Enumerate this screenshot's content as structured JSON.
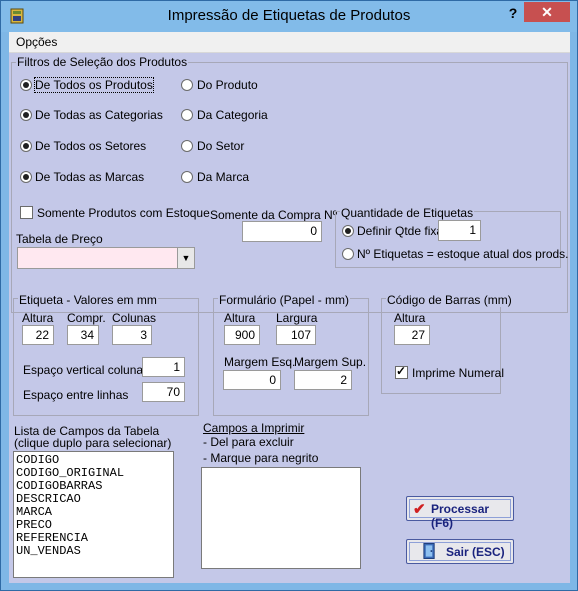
{
  "window": {
    "title": "Impressão de Etiquetas de Produtos",
    "help_label": "?",
    "close_label": "✕"
  },
  "menu": {
    "options": "Opções"
  },
  "filters": {
    "title": "Filtros de Seleção dos Produtos",
    "all_products": "De Todos os Produtos",
    "product": "Do Produto",
    "all_categories": "De Todas as Categorias",
    "category": "Da Categoria",
    "all_sectors": "De Todos os Setores",
    "sector": "Do Setor",
    "all_brands": "De Todas as Marcas",
    "brand": "Da Marca",
    "only_stock": "Somente Produtos com Estoque",
    "price_table_label": "Tabela de Preço",
    "price_table_value": "",
    "purchase_label": "Somente da Compra Nº",
    "purchase_value": "0"
  },
  "quantity": {
    "title": "Quantidade de Etiquetas",
    "fixed_label": "Definir Qtde fixa",
    "fixed_value": "1",
    "stock_label": "Nº Etiquetas = estoque atual dos prods."
  },
  "label_values": {
    "title": "Etiqueta - Valores em mm",
    "height_label": "Altura",
    "height": "22",
    "length_label": "Compr.",
    "length": "34",
    "columns_label": "Colunas",
    "columns": "3",
    "vspace_label": "Espaço vertical colunas",
    "vspace": "1",
    "linespace_label": "Espaço entre linhas",
    "linespace": "70"
  },
  "form": {
    "title": "Formulário (Papel - mm)",
    "height_label": "Altura",
    "height": "900",
    "width_label": "Largura",
    "width": "107",
    "margin_left_label": "Margem Esq.",
    "margin_left": "0",
    "margin_top_label": "Margem Sup.",
    "margin_top": "2"
  },
  "barcode": {
    "title": "Código de Barras (mm)",
    "height_label": "Altura",
    "height": "27",
    "print_numeral": "Imprime Numeral"
  },
  "fields_list": {
    "title_line1": "Lista de Campos da Tabela",
    "title_line2": "(clique duplo para selecionar)",
    "items": [
      "CODIGO",
      "CODIGO_ORIGINAL",
      "CODIGOBARRAS",
      "DESCRICAO",
      "MARCA",
      "PRECO",
      "REFERENCIA",
      "UN_VENDAS"
    ]
  },
  "print_fields": {
    "title": "Campos a Imprimir",
    "hint1": "- Del para excluir",
    "hint2": "- Marque para negrito"
  },
  "buttons": {
    "process": "Processar (F6)",
    "exit": "Sair (ESC)"
  },
  "colors": {
    "client_bg": "#c4c8e8",
    "title_bg": "#82bbe9",
    "close_bg": "#c75050",
    "button_text": "#1a237e"
  }
}
